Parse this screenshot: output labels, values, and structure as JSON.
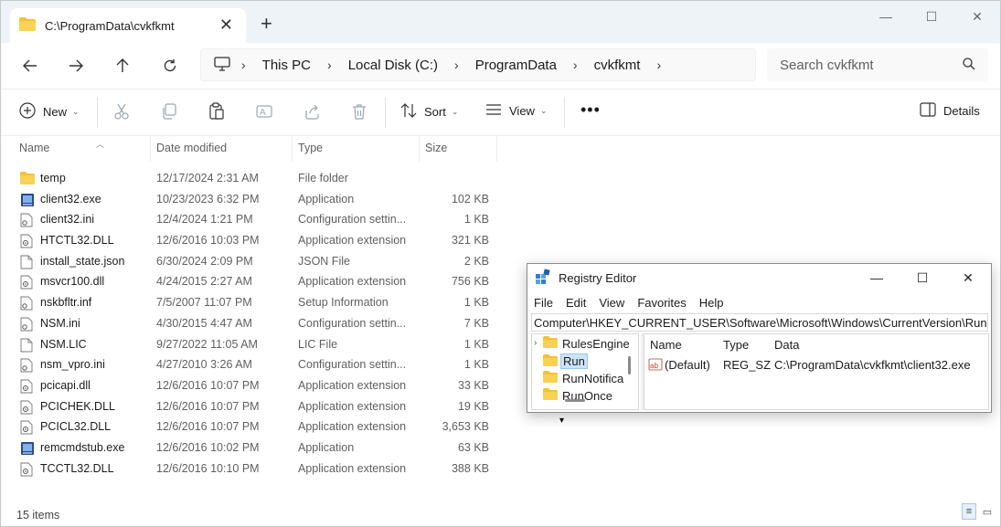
{
  "tab": {
    "title": "C:\\ProgramData\\cvkfkmt"
  },
  "breadcrumb": [
    "This PC",
    "Local Disk (C:)",
    "ProgramData",
    "cvkfkmt"
  ],
  "search": {
    "placeholder": "Search cvkfkmt"
  },
  "toolbar": {
    "new_label": "New",
    "sort_label": "Sort",
    "view_label": "View",
    "details_label": "Details"
  },
  "columns": {
    "name": "Name",
    "date": "Date modified",
    "type": "Type",
    "size": "Size"
  },
  "files": [
    {
      "name": "temp",
      "date": "12/17/2024 2:31 AM",
      "type": "File folder",
      "size": "",
      "icon": "folder-icon"
    },
    {
      "name": "client32.exe",
      "date": "10/23/2023 6:32 PM",
      "type": "Application",
      "size": "102 KB",
      "icon": "app-exe-icon"
    },
    {
      "name": "client32.ini",
      "date": "12/4/2024 1:21 PM",
      "type": "Configuration settin...",
      "size": "1 KB",
      "icon": "config-file-icon"
    },
    {
      "name": "HTCTL32.DLL",
      "date": "12/6/2016 10:03 PM",
      "type": "Application extension",
      "size": "321 KB",
      "icon": "dll-file-icon"
    },
    {
      "name": "install_state.json",
      "date": "6/30/2024 2:09 PM",
      "type": "JSON File",
      "size": "2 KB",
      "icon": "document-icon"
    },
    {
      "name": "msvcr100.dll",
      "date": "4/24/2015 2:27 AM",
      "type": "Application extension",
      "size": "756 KB",
      "icon": "dll-file-icon"
    },
    {
      "name": "nskbfltr.inf",
      "date": "7/5/2007 11:07 PM",
      "type": "Setup Information",
      "size": "1 KB",
      "icon": "config-file-icon"
    },
    {
      "name": "NSM.ini",
      "date": "4/30/2015 4:47 AM",
      "type": "Configuration settin...",
      "size": "7 KB",
      "icon": "config-file-icon"
    },
    {
      "name": "NSM.LIC",
      "date": "9/27/2022 11:05 AM",
      "type": "LIC File",
      "size": "1 KB",
      "icon": "document-icon"
    },
    {
      "name": "nsm_vpro.ini",
      "date": "4/27/2010 3:26 AM",
      "type": "Configuration settin...",
      "size": "1 KB",
      "icon": "config-file-icon"
    },
    {
      "name": "pcicapi.dll",
      "date": "12/6/2016 10:07 PM",
      "type": "Application extension",
      "size": "33 KB",
      "icon": "dll-file-icon"
    },
    {
      "name": "PCICHEK.DLL",
      "date": "12/6/2016 10:07 PM",
      "type": "Application extension",
      "size": "19 KB",
      "icon": "dll-file-icon"
    },
    {
      "name": "PCICL32.DLL",
      "date": "12/6/2016 10:07 PM",
      "type": "Application extension",
      "size": "3,653 KB",
      "icon": "dll-file-icon"
    },
    {
      "name": "remcmdstub.exe",
      "date": "12/6/2016 10:02 PM",
      "type": "Application",
      "size": "63 KB",
      "icon": "app-exe-icon"
    },
    {
      "name": "TCCTL32.DLL",
      "date": "12/6/2016 10:10 PM",
      "type": "Application extension",
      "size": "388 KB",
      "icon": "dll-file-icon"
    }
  ],
  "status": {
    "item_count": "15 items"
  },
  "registry": {
    "title": "Registry Editor",
    "menu": [
      "File",
      "Edit",
      "View",
      "Favorites",
      "Help"
    ],
    "path": "Computer\\HKEY_CURRENT_USER\\Software\\Microsoft\\Windows\\CurrentVersion\\Run",
    "tree": [
      "RulesEngine",
      "Run",
      "RunNotifica",
      "RunOnce"
    ],
    "value_columns": {
      "name": "Name",
      "type": "Type",
      "data": "Data"
    },
    "values": [
      {
        "name": "(Default)",
        "type": "REG_SZ",
        "data": "C:\\ProgramData\\cvkfkmt\\client32.exe"
      }
    ]
  },
  "colors": {
    "accent": "#0067c0",
    "folder": "#f3c13a",
    "selection": "#cce4f7"
  }
}
